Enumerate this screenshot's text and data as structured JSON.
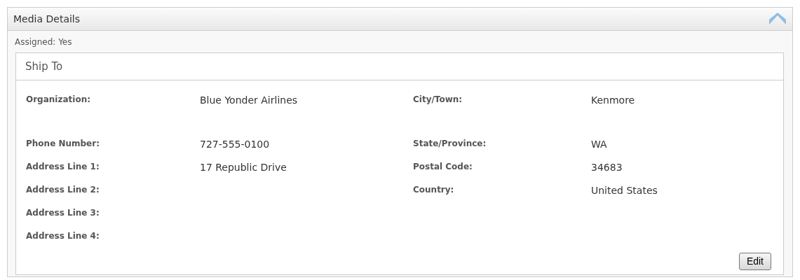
{
  "panel": {
    "title": "Media Details",
    "expanded": true
  },
  "assigned": "Assigned: Yes",
  "ship_to": {
    "title": "Ship To",
    "left_fields": [
      {
        "label": "Organization:",
        "value": "Blue Yonder Airlines"
      },
      {
        "label": "Phone Number:",
        "value": "727-555-0100"
      },
      {
        "label": "Address Line 1:",
        "value": "17 Republic Drive"
      },
      {
        "label": "Address Line 2:"
      },
      {
        "label": "Address Line 3:"
      },
      {
        "label": "Address Line 4:"
      }
    ],
    "right_fields": [
      {
        "label": "City/Town:",
        "value": "Kenmore"
      },
      {
        "label": "State/Province:",
        "value": "WA"
      },
      {
        "label": "Postal Code:",
        "value": "34683"
      },
      {
        "label": "Country:",
        "value": "United States"
      }
    ],
    "button": "Edit"
  }
}
